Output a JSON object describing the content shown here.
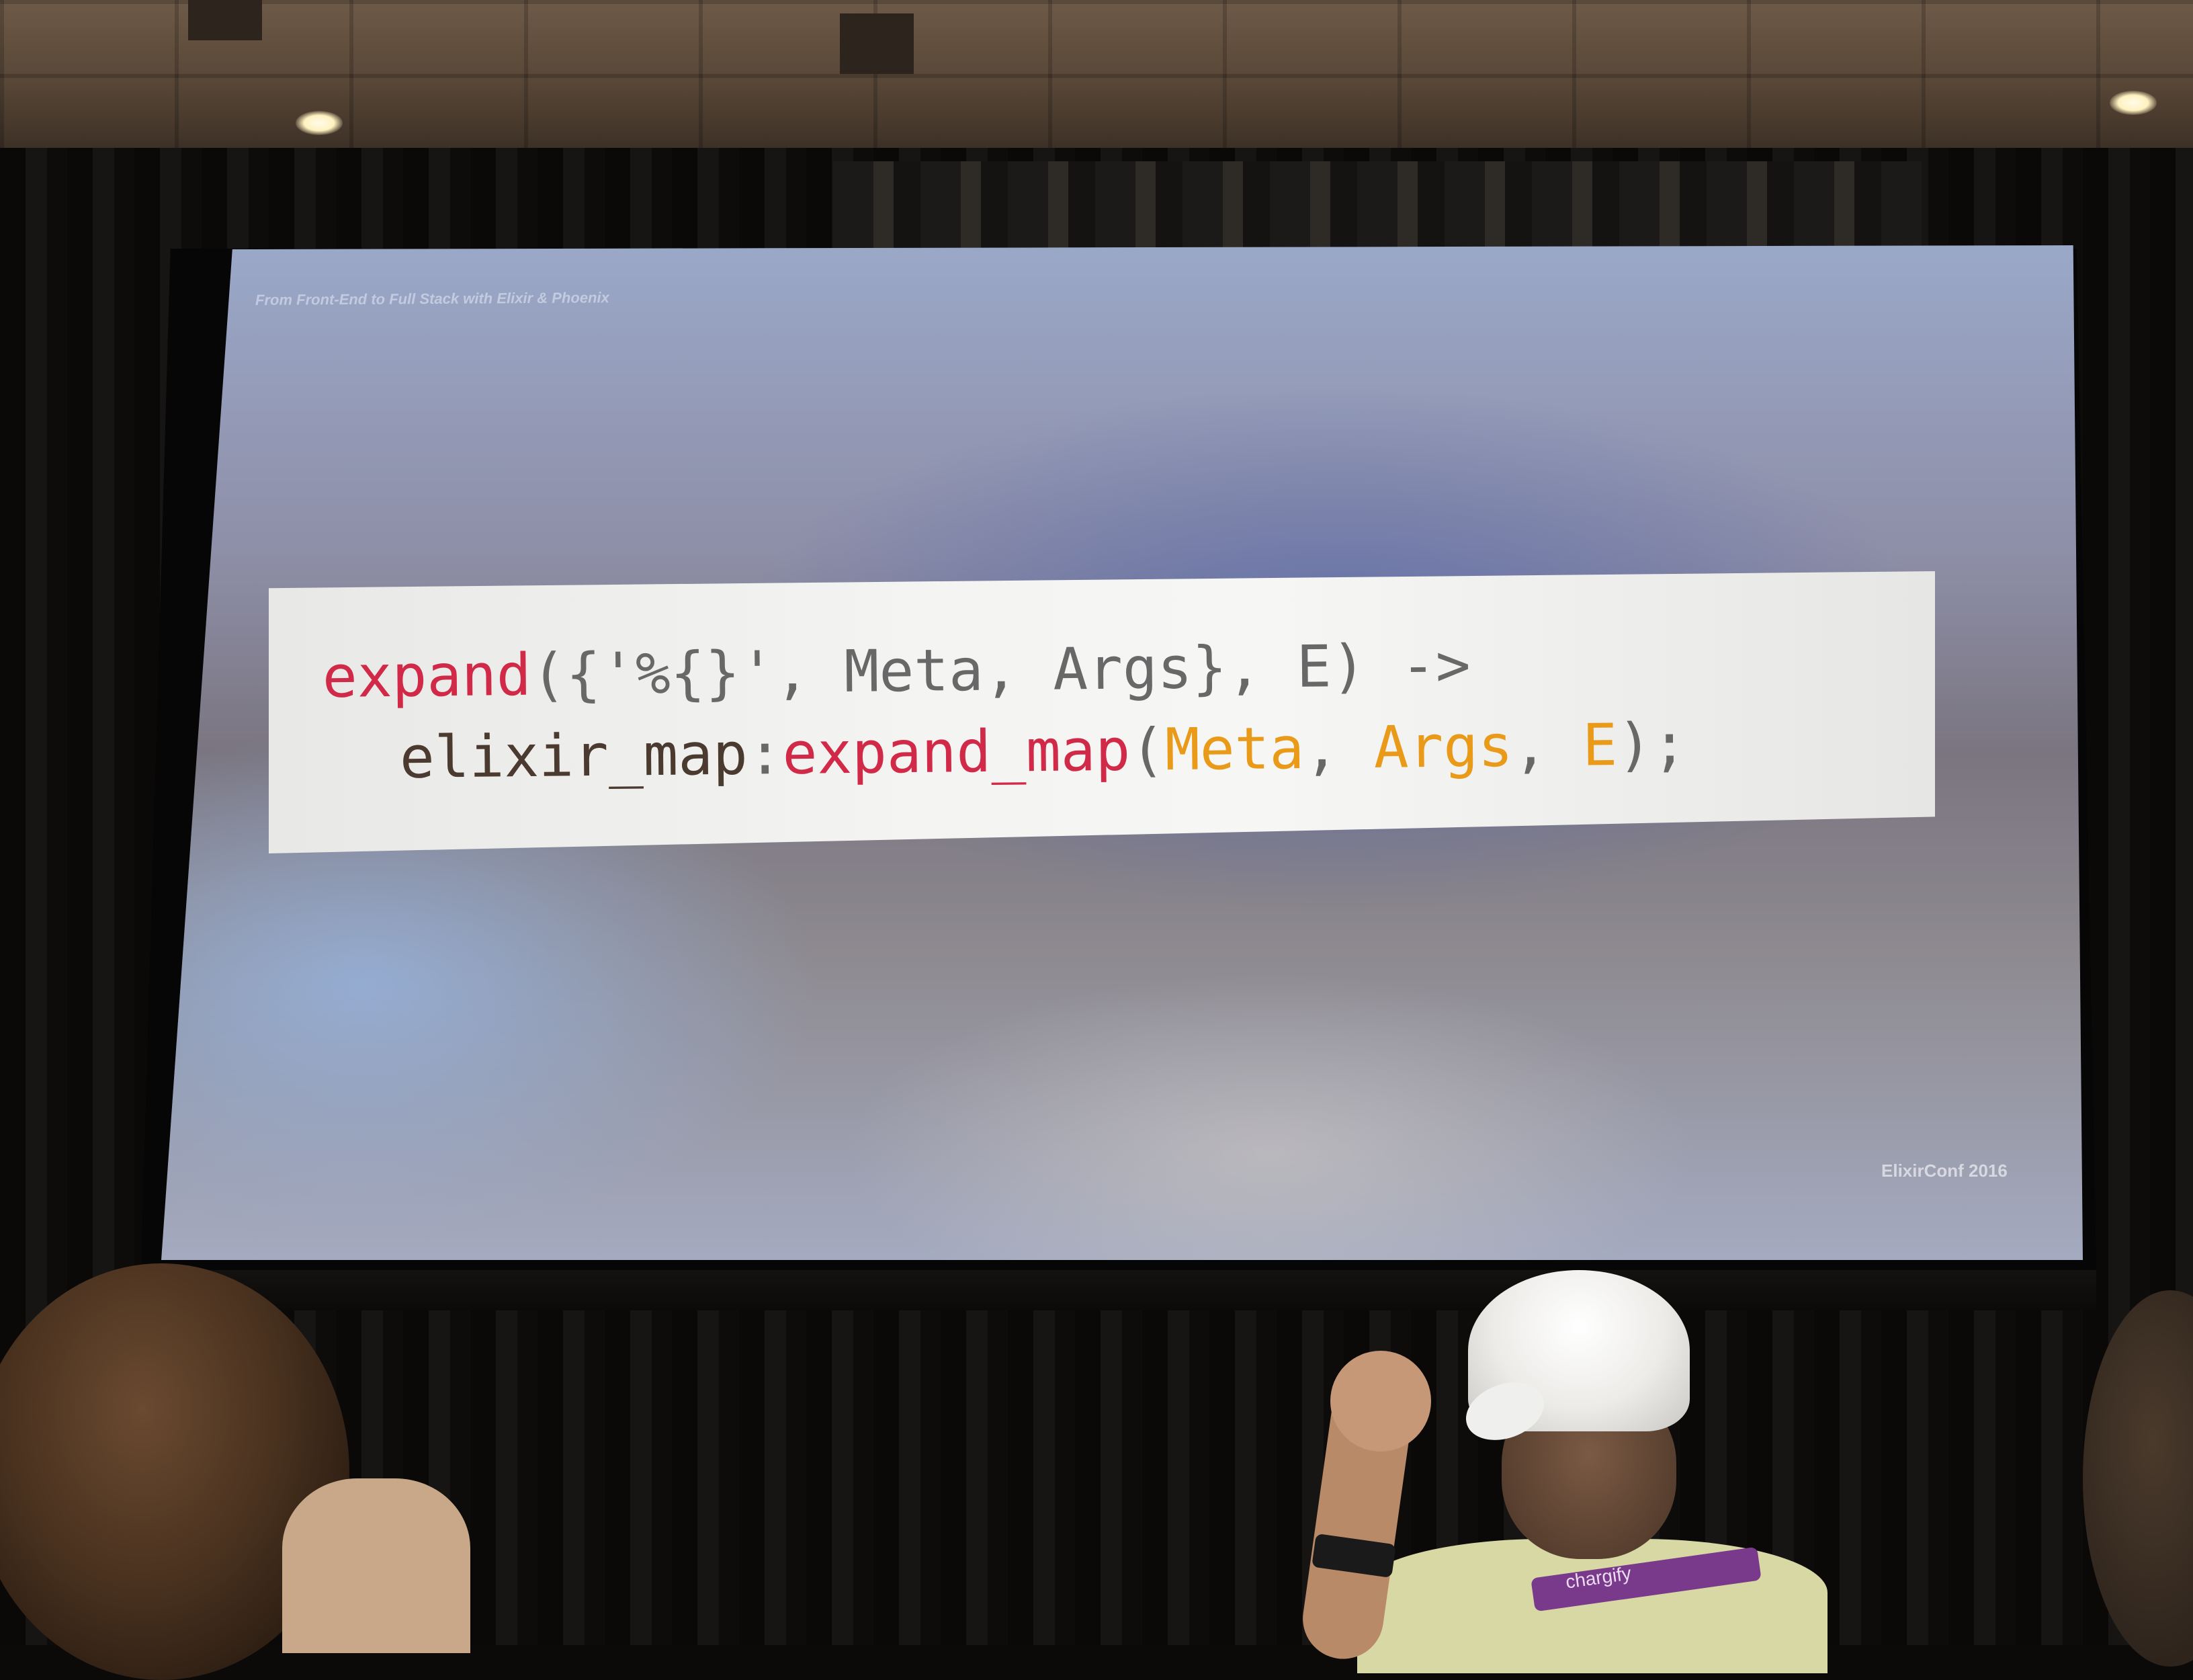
{
  "slide": {
    "header": "From Front-End to Full Stack with Elixir & Phoenix",
    "footer": "ElixirConf 2016",
    "code": {
      "line1": {
        "fn": "expand",
        "open": "({'%{}', Meta, Args}, E) ->"
      },
      "line2": {
        "module": "elixir_map",
        "colon": ":",
        "fn": "expand_map",
        "open_paren": "(",
        "arg1": "Meta",
        "sep1": ", ",
        "arg2": "Args",
        "sep2": ", ",
        "arg3": "E",
        "close": ");"
      }
    }
  },
  "audience": {
    "lanyard_text": "chargify"
  },
  "colors": {
    "function": "#d12a48",
    "punctuation": "#686868",
    "atom": "#4a3a30",
    "variable": "#e89a18",
    "code_background": "#f2f2f0"
  }
}
